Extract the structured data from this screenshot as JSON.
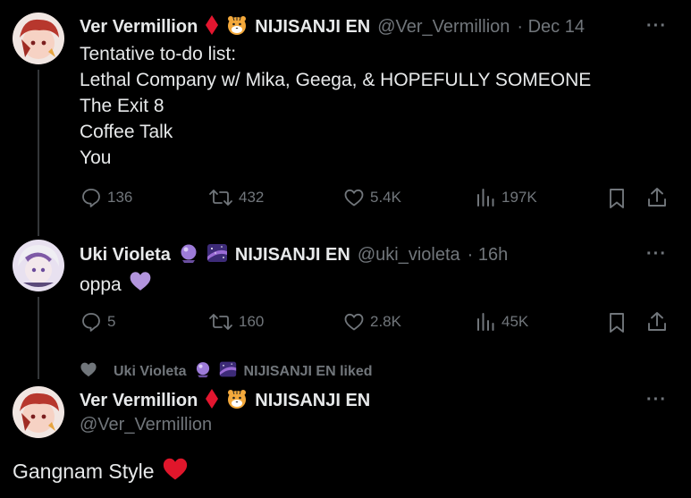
{
  "tweet1": {
    "display_name": "Ver Vermillion",
    "affiliation": "NIJISANJI EN",
    "handle": "@Ver_Vermillion",
    "time": "· Dec 14",
    "more": "···",
    "lines": [
      "Tentative to-do list:",
      "Lethal Company w/ Mika, Geega, & HOPEFULLY SOMEONE",
      "The Exit 8",
      "Coffee Talk",
      "You"
    ],
    "replies": "136",
    "reposts": "432",
    "likes": "5.4K",
    "views": "197K"
  },
  "tweet2": {
    "display_name": "Uki Violeta",
    "affiliation": "NIJISANJI EN",
    "handle": "@uki_violeta",
    "time": "· 16h",
    "more": "···",
    "text": "oppa",
    "replies": "5",
    "reposts": "160",
    "likes": "2.8K",
    "views": "45K"
  },
  "liked_banner": {
    "name": "Uki Violeta",
    "affiliation_suffix": "NIJISANJI EN liked"
  },
  "tweet3": {
    "display_name": "Ver Vermillion",
    "affiliation": "NIJISANJI EN",
    "handle": "@Ver_Vermillion",
    "more": "···",
    "text": "Gangnam Style"
  },
  "colors": {
    "background": "#000000",
    "text": "#e7e9ea",
    "muted": "#71767b",
    "diamond_red": "#e3162f",
    "heart_red": "#e0162b",
    "purple_heart": "#b294dd"
  },
  "icons": [
    "reply-icon",
    "repost-icon",
    "like-icon",
    "views-icon",
    "bookmark-icon",
    "share-icon",
    "diamond-icon",
    "tiger-emoji-icon",
    "crystal-ball-icon",
    "galaxy-emoji-icon",
    "purple-heart-icon",
    "red-heart-icon",
    "liked-heart-icon"
  ]
}
